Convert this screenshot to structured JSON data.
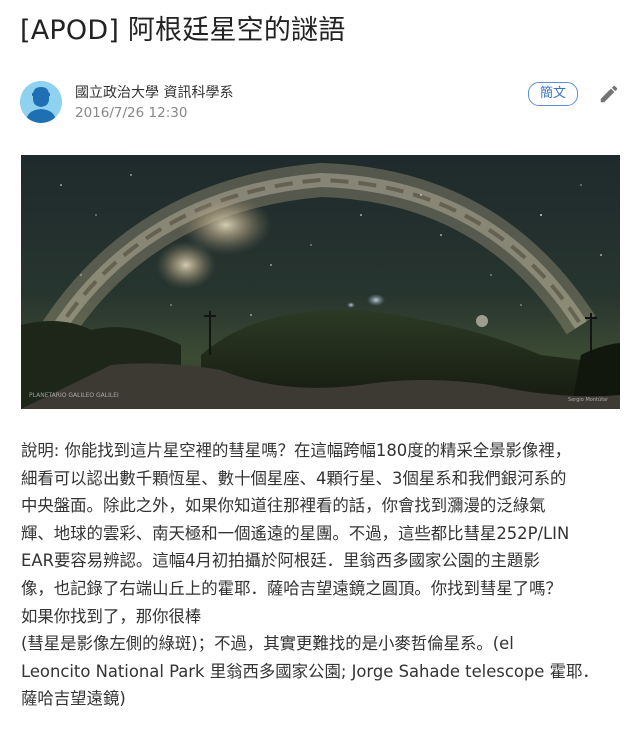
{
  "post": {
    "title": "[APOD] 阿根廷星空的謎語",
    "author": "國立政治大學 資訊科學系",
    "date": "2016/7/26 12:30",
    "lang_toggle_label": "簡文",
    "edit_icon": "pencil-icon",
    "avatar_icon": "user-silhouette-icon"
  },
  "image": {
    "subject": "Milky Way panorama over El Leoncito National Park",
    "watermark_left": "PLANETARIO GALILEO GALILEI",
    "credit": "Sergio Montúfar"
  },
  "description_lines": [
    "說明: 你能找到這片星空裡的彗星嗎？在這幅跨幅180度的精采全景影像裡，",
    "細看可以認出數千顆恆星、數十個星座、4顆行星、3個星系和我們銀河系的",
    "中央盤面。除此之外，如果你知道往那裡看的話，你會找到瀰漫的泛綠氣",
    "輝、地球的雲彩、南天極和一個遙遠的星團。不過，這些都比彗星252P/LIN",
    "EAR要容易辨認。這幅4月初拍攝於阿根廷．里翁西多國家公園的主題影",
    "像，也記錄了右端山丘上的霍耶．薩哈吉望遠鏡之圓頂。你找到彗星了嗎？",
    "如果你找到了，那你很棒",
    "(彗星是影像左側的綠斑)；不過，其實更難找的是小麥哲倫星系。(el",
    "Leoncito National Park 里翁西多國家公園; Jorge Sahade telescope 霍耶．",
    "薩哈吉望遠鏡)"
  ],
  "colors": {
    "accent": "#3a72c8",
    "avatar_bg": "#8fd2ef",
    "text": "#333333",
    "muted": "#888888"
  }
}
